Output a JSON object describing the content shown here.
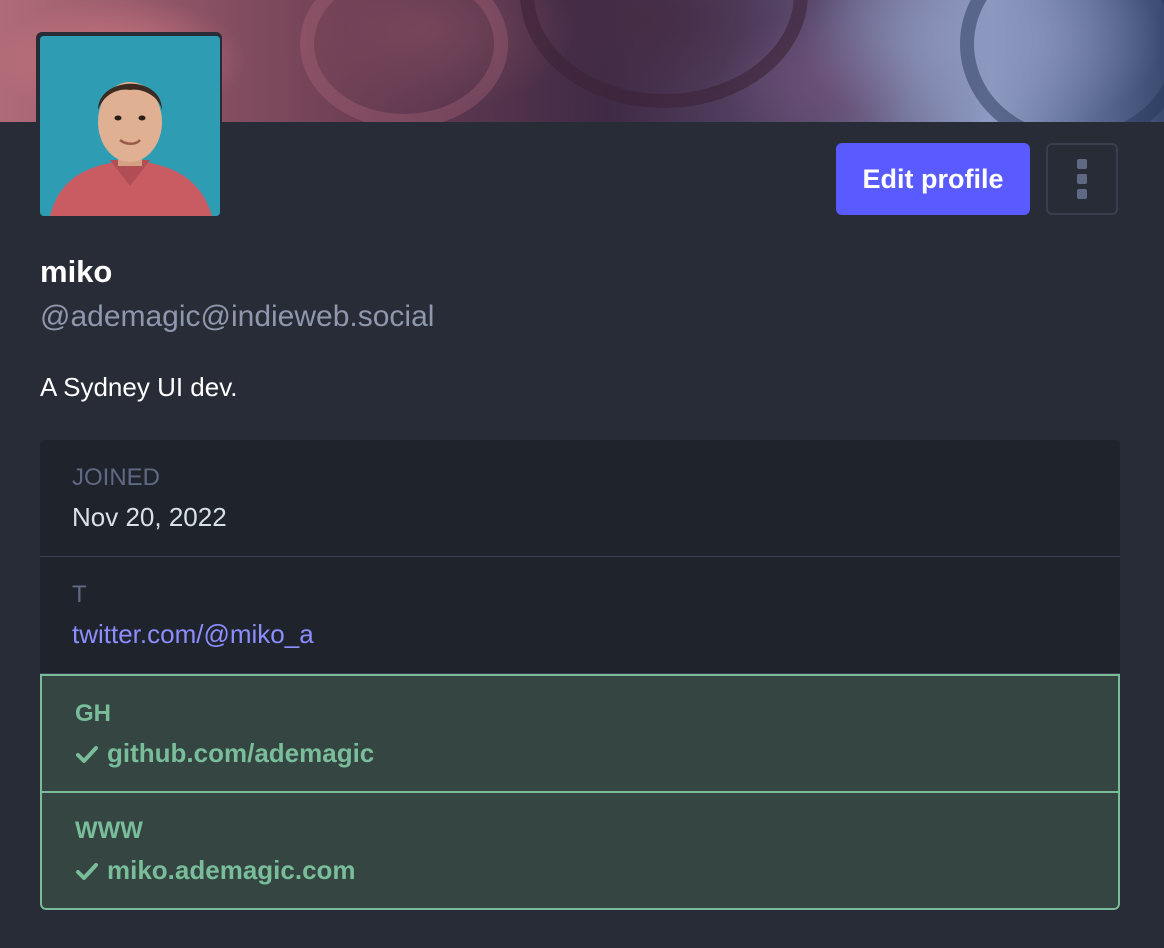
{
  "profile": {
    "display_name": "miko",
    "handle": "@ademagic@indieweb.social",
    "bio": "A Sydney UI dev.",
    "edit_label": "Edit profile"
  },
  "fields": {
    "joined": {
      "label": "JOINED",
      "value": "Nov 20, 2022"
    },
    "twitter": {
      "label": "T",
      "value": "twitter.com/@miko_a"
    },
    "github": {
      "label": "GH",
      "value": "github.com/ademagic"
    },
    "website": {
      "label": "WWW",
      "value": "miko.ademagic.com"
    }
  },
  "colors": {
    "accent": "#595aff",
    "background": "#282c37",
    "verified": "#79bd9a",
    "link": "#8c8dff"
  },
  "icons": {
    "more": "more-vertical-icon",
    "verified": "check-icon"
  }
}
